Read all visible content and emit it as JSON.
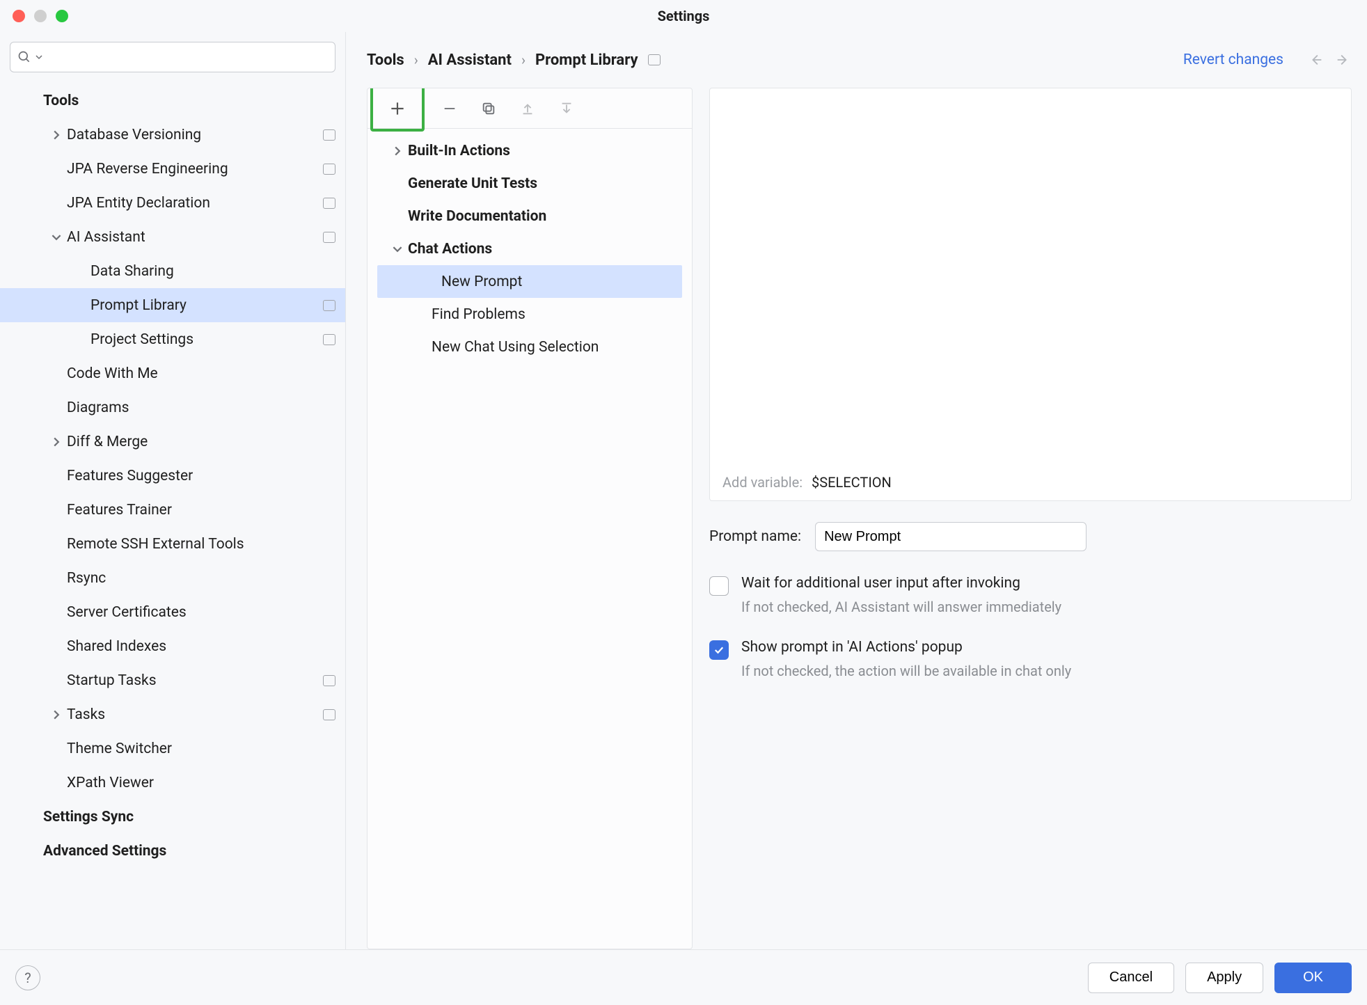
{
  "window": {
    "title": "Settings"
  },
  "search": {
    "placeholder": ""
  },
  "sidebar": {
    "items": [
      {
        "label": "Tools",
        "bold": true,
        "indent": 0
      },
      {
        "label": "Database Versioning",
        "indent": 1,
        "arrow": "right",
        "box": true
      },
      {
        "label": "JPA Reverse Engineering",
        "indent": 1,
        "box": true
      },
      {
        "label": "JPA Entity Declaration",
        "indent": 1,
        "box": true
      },
      {
        "label": "AI Assistant",
        "indent": 1,
        "arrow": "down",
        "box": true
      },
      {
        "label": "Data Sharing",
        "indent": 2
      },
      {
        "label": "Prompt Library",
        "indent": 2,
        "selected": true,
        "box": true
      },
      {
        "label": "Project Settings",
        "indent": 2,
        "box": true
      },
      {
        "label": "Code With Me",
        "indent": 1
      },
      {
        "label": "Diagrams",
        "indent": 1
      },
      {
        "label": "Diff & Merge",
        "indent": 1,
        "arrow": "right"
      },
      {
        "label": "Features Suggester",
        "indent": 1
      },
      {
        "label": "Features Trainer",
        "indent": 1
      },
      {
        "label": "Remote SSH External Tools",
        "indent": 1
      },
      {
        "label": "Rsync",
        "indent": 1
      },
      {
        "label": "Server Certificates",
        "indent": 1
      },
      {
        "label": "Shared Indexes",
        "indent": 1
      },
      {
        "label": "Startup Tasks",
        "indent": 1,
        "box": true
      },
      {
        "label": "Tasks",
        "indent": 1,
        "arrow": "right",
        "box": true
      },
      {
        "label": "Theme Switcher",
        "indent": 1
      },
      {
        "label": "XPath Viewer",
        "indent": 1
      },
      {
        "label": "Settings Sync",
        "bold": true,
        "indent": 0
      },
      {
        "label": "Advanced Settings",
        "bold": true,
        "indent": 0
      }
    ]
  },
  "breadcrumb": {
    "segments": [
      "Tools",
      "AI Assistant",
      "Prompt Library"
    ],
    "revert": "Revert changes"
  },
  "prompt_tree": [
    {
      "label": "Built-In Actions",
      "bold": true,
      "arrow": "right",
      "indent": 0
    },
    {
      "label": "Generate Unit Tests",
      "bold": true,
      "indent": 0
    },
    {
      "label": "Write Documentation",
      "bold": true,
      "indent": 0
    },
    {
      "label": "Chat Actions",
      "bold": true,
      "arrow": "down",
      "indent": 0
    },
    {
      "label": "New Prompt",
      "indent": 1,
      "selected": true
    },
    {
      "label": "Find Problems",
      "indent": 1
    },
    {
      "label": "New Chat Using Selection",
      "indent": 1
    }
  ],
  "editor": {
    "add_variable_label": "Add variable:",
    "variable_chip": "$SELECTION"
  },
  "form": {
    "prompt_name_label": "Prompt name:",
    "prompt_name_value": "New Prompt",
    "wait_label": "Wait for additional user input after invoking",
    "wait_hint": "If not checked, AI Assistant will answer immediately",
    "show_label": "Show prompt in 'AI Actions' popup",
    "show_hint": "If not checked, the action will be available in chat only"
  },
  "footer": {
    "cancel": "Cancel",
    "apply": "Apply",
    "ok": "OK"
  }
}
